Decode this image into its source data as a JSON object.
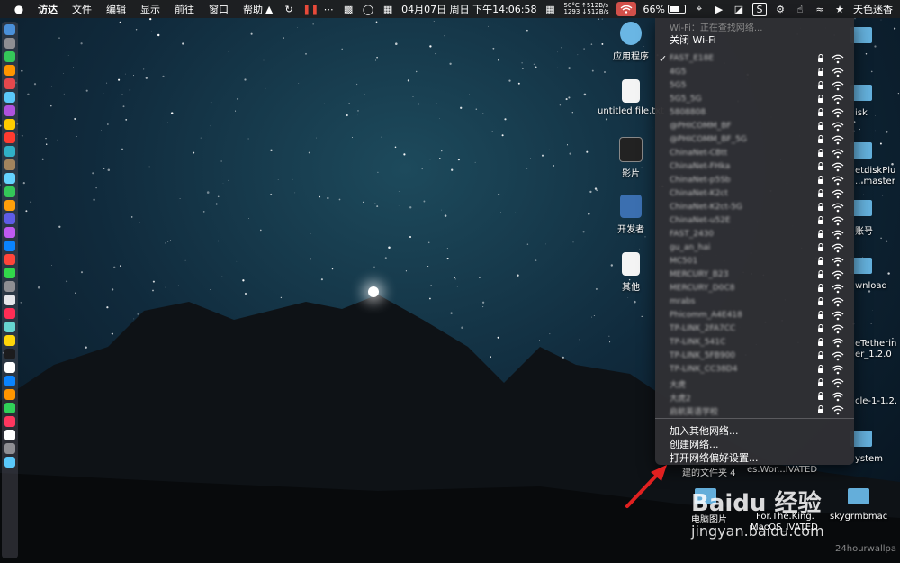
{
  "menubar": {
    "app_name": "访达",
    "menus": [
      "文件",
      "编辑",
      "显示",
      "前往",
      "窗口",
      "帮助"
    ],
    "clock": "04月07日 周日 下午14:06:58",
    "net_speed_lines": [
      "50°C  ↑512B/s",
      "1293  ↓512B/s"
    ],
    "battery_percent": "66%",
    "user_name": "天色迷香"
  },
  "desktop_icons": [
    {
      "label": "应用程序"
    },
    {
      "label": "untitled file.txt"
    },
    {
      "label": "影片"
    },
    {
      "label": "开发者"
    },
    {
      "label": "其他"
    }
  ],
  "right_fragments": [
    "isk",
    "etdiskPlu",
    "...master",
    "账号",
    "wnload",
    "eTetherin",
    "er_1.2.0",
    "cle-1-1.2.",
    "ystem"
  ],
  "bottom_fragments": [
    "建的文件夹 4",
    "es.Wor...IVATED",
    "电脑图片",
    "For.The.King.",
    "MacOS_IVATED",
    "skygrmbmac"
  ],
  "wifi_menu": {
    "status": "Wi-Fi：正在查找网络...",
    "toggle": "关闭 Wi-Fi",
    "networks": [
      {
        "name": "FAST_E18E",
        "checked": true
      },
      {
        "name": "4G5",
        "checked": false
      },
      {
        "name": "5G5",
        "checked": false
      },
      {
        "name": "5G5_5G",
        "checked": false
      },
      {
        "name": "5808808",
        "checked": false
      },
      {
        "name": "@PHICOMM_BF",
        "checked": false
      },
      {
        "name": "@PHICOMM_BF_5G",
        "checked": false
      },
      {
        "name": "ChinaNet-CBtt",
        "checked": false
      },
      {
        "name": "ChinaNet-FHka",
        "checked": false
      },
      {
        "name": "ChinaNet-p5Sb",
        "checked": false
      },
      {
        "name": "ChinaNet-K2ct",
        "checked": false
      },
      {
        "name": "ChinaNet-K2ct-5G",
        "checked": false
      },
      {
        "name": "ChinaNet-u52E",
        "checked": false
      },
      {
        "name": "FAST_2430",
        "checked": false
      },
      {
        "name": "gu_an_hai",
        "checked": false
      },
      {
        "name": "MC501",
        "checked": false
      },
      {
        "name": "MERCURY_B23",
        "checked": false
      },
      {
        "name": "MERCURY_D0C8",
        "checked": false
      },
      {
        "name": "mrabs",
        "checked": false
      },
      {
        "name": "Phicomm_A4E418",
        "checked": false
      },
      {
        "name": "TP-LINK_2FA7CC",
        "checked": false
      },
      {
        "name": "TP-LINK_541C",
        "checked": false
      },
      {
        "name": "TP-LINK_5FB900",
        "checked": false
      },
      {
        "name": "TP-LINK_CC38D4",
        "checked": false
      },
      {
        "name": "大虎",
        "checked": false
      },
      {
        "name": "大虎2",
        "checked": false
      },
      {
        "name": "启航英语学校",
        "checked": false
      }
    ],
    "actions": [
      "加入其他网络...",
      "创建网络...",
      "打开网络偏好设置..."
    ]
  },
  "watermark": {
    "brand": "Baidu 经验",
    "url": "jingyan.baidu.com",
    "corner": "24hourwallpa"
  },
  "colors": {
    "wifi_active": "#d2504a",
    "menubar": "#1e1e20",
    "menu_bg": "#303034",
    "arrow": "#e02020"
  }
}
